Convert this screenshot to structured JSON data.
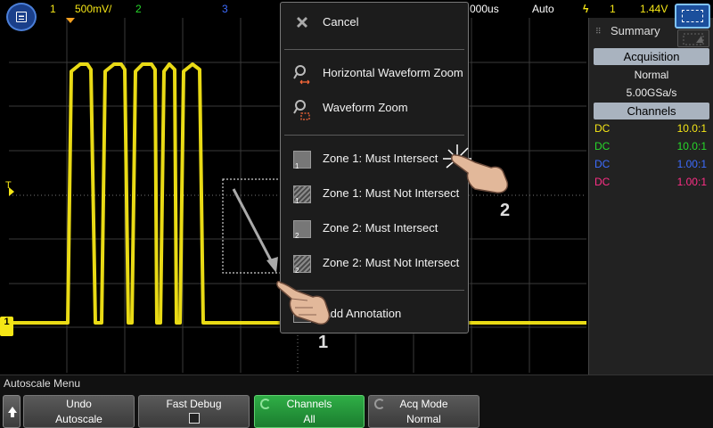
{
  "topbar": {
    "ch1_num": "1",
    "ch1_scale": "500mV/",
    "ch2_num": "2",
    "ch3_num": "3",
    "time_scale": "000us",
    "trigger_mode": "Auto",
    "trig_source": "1",
    "trig_level": "1.44V"
  },
  "menu_button": {
    "icon": "menu-icon"
  },
  "context_menu": {
    "items": [
      {
        "label": "Cancel",
        "icon": "close-icon"
      },
      {
        "label": "Horizontal Waveform Zoom",
        "icon": "horizontal-zoom-icon"
      },
      {
        "label": "Waveform Zoom",
        "icon": "zoom-icon"
      },
      {
        "label": "Zone 1: Must Intersect",
        "icon": "zone-1-intersect-icon",
        "num": "1"
      },
      {
        "label": "Zone 1: Must Not Intersect",
        "icon": "zone-1-not-intersect-icon",
        "num": "1"
      },
      {
        "label": "Zone 2: Must Intersect",
        "icon": "zone-2-intersect-icon",
        "num": "2"
      },
      {
        "label": "Zone 2: Must Not Intersect",
        "icon": "zone-2-not-intersect-icon",
        "num": "2"
      },
      {
        "label": "Add Annotation",
        "icon": "annotation-icon"
      }
    ]
  },
  "sidebar": {
    "title": "Summary",
    "acquisition_header": "Acquisition",
    "acq_mode": "Normal",
    "sample_rate": "5.00GSa/s",
    "channels_header": "Channels",
    "channels": [
      {
        "coupling": "DC",
        "ratio": "10.0:1",
        "color": "#f5e616"
      },
      {
        "coupling": "DC",
        "ratio": "10.0:1",
        "color": "#27d82a"
      },
      {
        "coupling": "DC",
        "ratio": "1.00:1",
        "color": "#3d6cff"
      },
      {
        "coupling": "DC",
        "ratio": "1.00:1",
        "color": "#ff2f86"
      }
    ]
  },
  "markers": {
    "trigger": "T",
    "ground": "1"
  },
  "softkeys": {
    "menu_caption": "Autoscale Menu",
    "undo": {
      "line1": "Undo",
      "line2": "Autoscale"
    },
    "fast_debug": {
      "line1": "Fast Debug"
    },
    "channels": {
      "line1": "Channels",
      "line2": "All"
    },
    "acq_mode": {
      "line1": "Acq Mode",
      "line2": "Normal"
    }
  },
  "annotations": {
    "step1": "1",
    "step2": "2"
  },
  "colors": {
    "ch1": "#f5e616",
    "accent": "#1b4f9c",
    "softkey_active": "#2fae46"
  }
}
